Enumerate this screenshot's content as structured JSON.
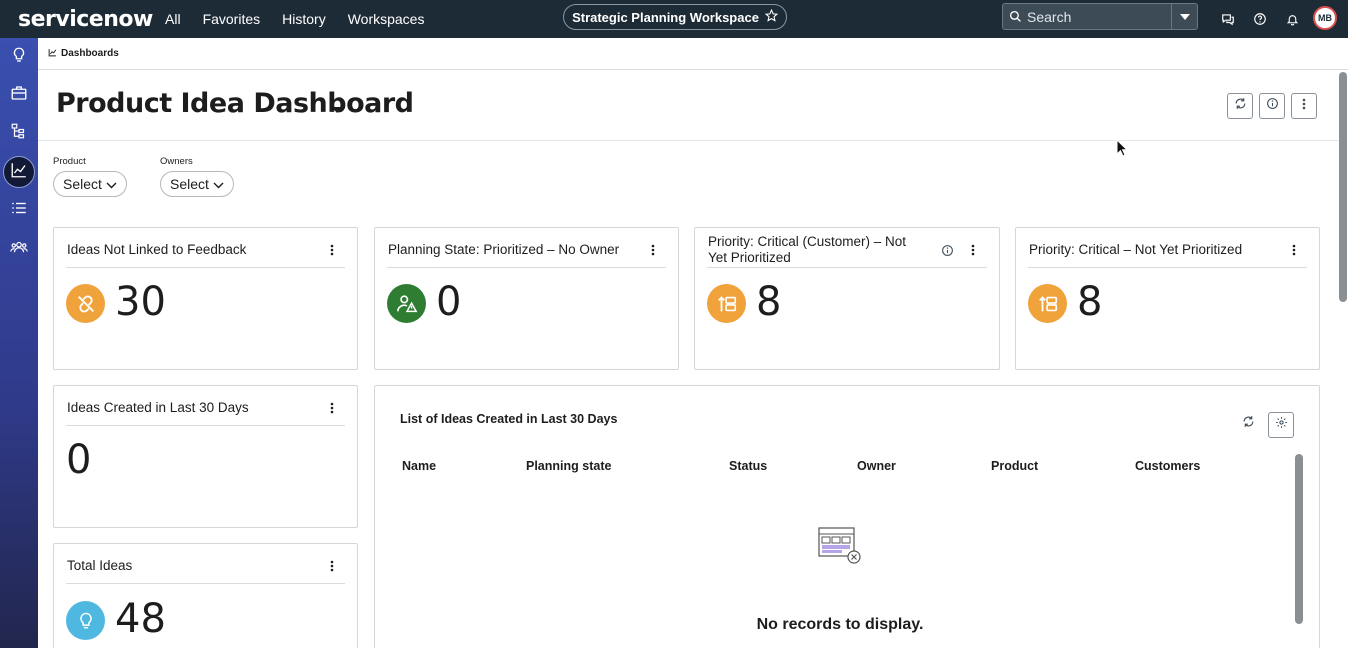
{
  "topbar": {
    "logo": "servicenow",
    "nav": [
      "All",
      "Favorites",
      "History",
      "Workspaces"
    ],
    "workspace": "Strategic Planning Workspace",
    "search_placeholder": "Search",
    "avatar_initials": "MB"
  },
  "breadcrumb": {
    "label": "Dashboards"
  },
  "header": {
    "title": "Product Idea Dashboard"
  },
  "filters": [
    {
      "label": "Product",
      "value": "Select"
    },
    {
      "label": "Owners",
      "value": "Select"
    }
  ],
  "cards": {
    "not_linked": {
      "title": "Ideas Not Linked to Feedback",
      "value": "30",
      "icon": "unlink-icon",
      "color": "#f0a23b"
    },
    "no_owner": {
      "title": "Planning State: Prioritized – No Owner",
      "value": "0",
      "icon": "user-warning-icon",
      "color": "#2e7d32"
    },
    "critical_customer": {
      "title": "Priority: Critical (Customer) – Not Yet Prioritized",
      "value": "8",
      "icon": "priority-icon",
      "color": "#f0a23b"
    },
    "critical": {
      "title": "Priority: Critical – Not Yet Prioritized",
      "value": "8",
      "icon": "priority-icon",
      "color": "#f0a23b"
    },
    "created_30": {
      "title": "Ideas Created in Last 30 Days",
      "value": "0"
    },
    "total": {
      "title": "Total Ideas",
      "value": "48",
      "icon": "lightbulb-icon",
      "color": "#4fb8e0"
    }
  },
  "list": {
    "title": "List of Ideas Created in Last 30 Days",
    "columns": [
      "Name",
      "Planning state",
      "Status",
      "Owner",
      "Product",
      "Customers"
    ],
    "empty_message": "No records to display."
  }
}
